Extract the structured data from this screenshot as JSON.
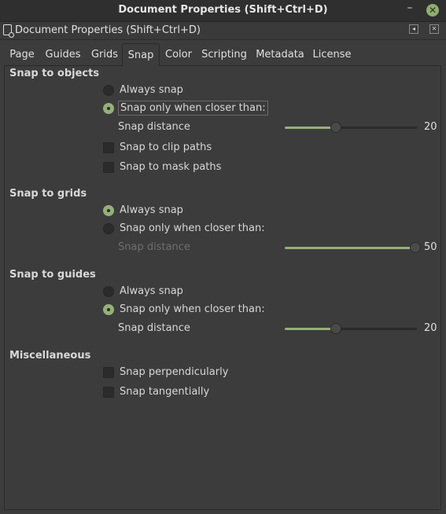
{
  "window": {
    "title": "Document Properties (Shift+Ctrl+D)",
    "dialog_title": "Document Properties (Shift+Ctrl+D)",
    "minimize_glyph": "–",
    "close_glyph": "✕",
    "accent_color": "#95b078"
  },
  "tabs": [
    {
      "label": "Page"
    },
    {
      "label": "Guides"
    },
    {
      "label": "Grids"
    },
    {
      "label": "Snap",
      "active": true
    },
    {
      "label": "Color"
    },
    {
      "label": "Scripting"
    },
    {
      "label": "Metadata"
    },
    {
      "label": "License"
    }
  ],
  "snap_objects": {
    "title": "Snap to objects",
    "always_snap": "Always snap",
    "closer_than": "Snap only when closer than:",
    "selected": "closer_than",
    "distance_label": "Snap distance",
    "distance_value": "20",
    "distance_fraction": 0.39,
    "clip_paths": "Snap to clip paths",
    "mask_paths": "Snap to mask paths"
  },
  "snap_grids": {
    "title": "Snap to grids",
    "always_snap": "Always snap",
    "closer_than": "Snap only when closer than:",
    "selected": "always",
    "distance_label": "Snap distance",
    "distance_value": "50",
    "distance_fraction": 1.0
  },
  "snap_guides": {
    "title": "Snap to guides",
    "always_snap": "Always snap",
    "closer_than": "Snap only when closer than:",
    "selected": "closer_than",
    "distance_label": "Snap distance",
    "distance_value": "20",
    "distance_fraction": 0.39
  },
  "misc": {
    "title": "Miscellaneous",
    "perpendicularly": "Snap perpendicularly",
    "tangentially": "Snap tangentially"
  }
}
